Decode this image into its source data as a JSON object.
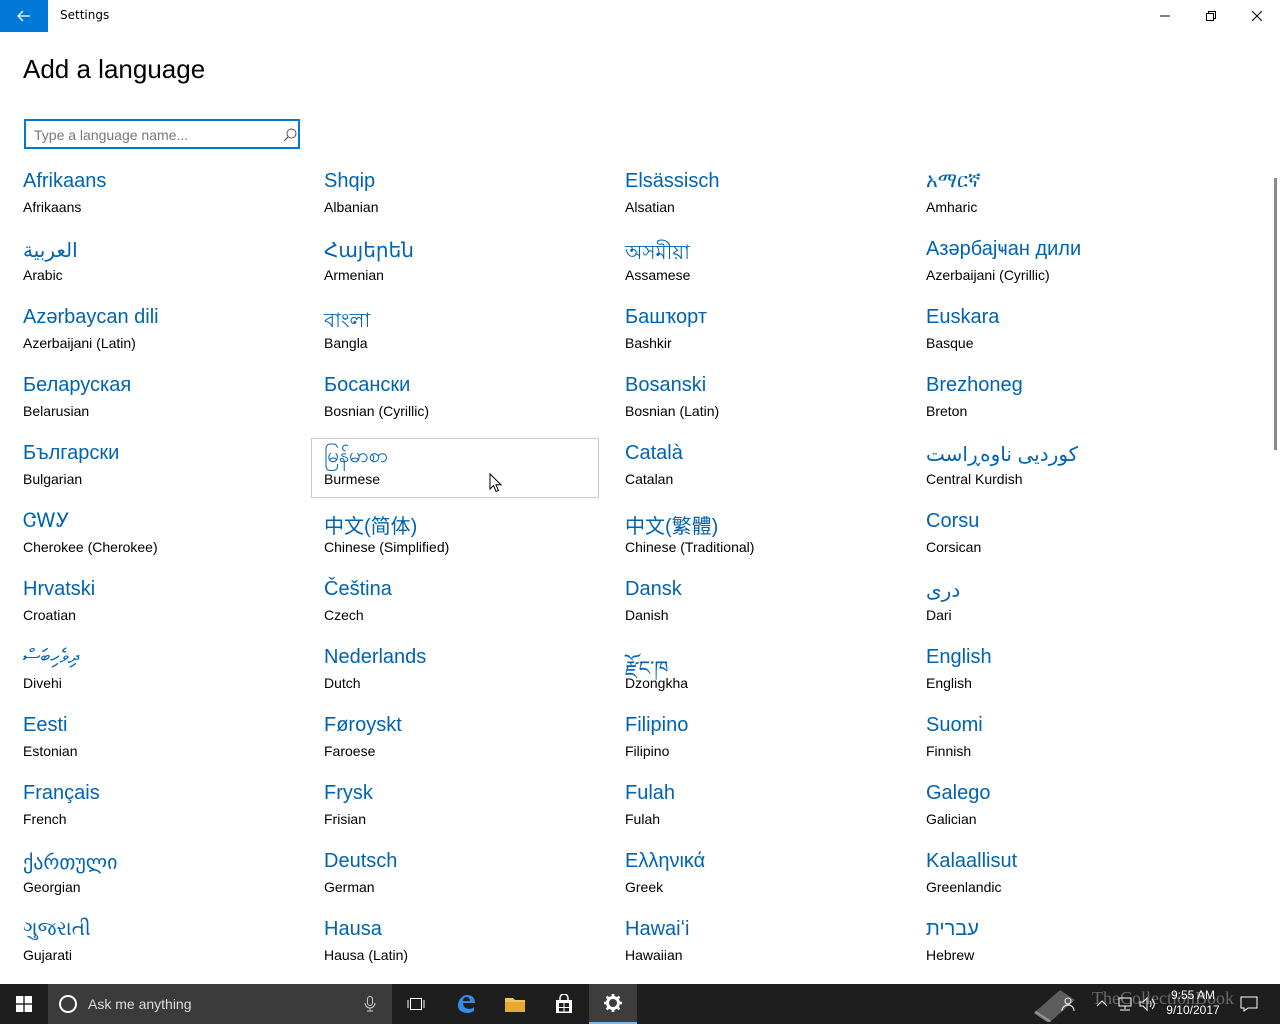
{
  "window": {
    "title": "Settings"
  },
  "page": {
    "title": "Add a language"
  },
  "search": {
    "placeholder": "Type a language name..."
  },
  "languages": [
    {
      "native": "Afrikaans",
      "english": "Afrikaans"
    },
    {
      "native": "Shqip",
      "english": "Albanian"
    },
    {
      "native": "Elsässisch",
      "english": "Alsatian"
    },
    {
      "native": "አማርኛ",
      "english": "Amharic"
    },
    {
      "native": "العربية",
      "english": "Arabic"
    },
    {
      "native": "Հայերեն",
      "english": "Armenian"
    },
    {
      "native": "অসমীয়া",
      "english": "Assamese"
    },
    {
      "native": "Азәрбајҹан дили",
      "english": "Azerbaijani (Cyrillic)"
    },
    {
      "native": "Azərbaycan dili",
      "english": "Azerbaijani (Latin)"
    },
    {
      "native": "বাংলা",
      "english": "Bangla"
    },
    {
      "native": "Башҡорт",
      "english": "Bashkir"
    },
    {
      "native": "Euskara",
      "english": "Basque"
    },
    {
      "native": "Беларуская",
      "english": "Belarusian"
    },
    {
      "native": "Босански",
      "english": "Bosnian (Cyrillic)"
    },
    {
      "native": "Bosanski",
      "english": "Bosnian (Latin)"
    },
    {
      "native": "Brezhoneg",
      "english": "Breton"
    },
    {
      "native": "Български",
      "english": "Bulgarian"
    },
    {
      "native": "မြန်မာစာ",
      "english": "Burmese"
    },
    {
      "native": "Català",
      "english": "Catalan"
    },
    {
      "native": "کوردیی ناوەڕاست",
      "english": "Central Kurdish"
    },
    {
      "native": "ᏣᎳᎩ",
      "english": "Cherokee (Cherokee)"
    },
    {
      "native": "中文(简体)",
      "english": "Chinese (Simplified)"
    },
    {
      "native": "中文(繁體)",
      "english": "Chinese (Traditional)"
    },
    {
      "native": "Corsu",
      "english": "Corsican"
    },
    {
      "native": "Hrvatski",
      "english": "Croatian"
    },
    {
      "native": "Čeština",
      "english": "Czech"
    },
    {
      "native": "Dansk",
      "english": "Danish"
    },
    {
      "native": "درى",
      "english": "Dari"
    },
    {
      "native": "ދިވެހިބަސް",
      "english": "Divehi"
    },
    {
      "native": "Nederlands",
      "english": "Dutch"
    },
    {
      "native": "རྫོང་ཁ",
      "english": "Dzongkha"
    },
    {
      "native": "English",
      "english": "English"
    },
    {
      "native": "Eesti",
      "english": "Estonian"
    },
    {
      "native": "Føroyskt",
      "english": "Faroese"
    },
    {
      "native": "Filipino",
      "english": "Filipino"
    },
    {
      "native": "Suomi",
      "english": "Finnish"
    },
    {
      "native": "Français",
      "english": "French"
    },
    {
      "native": "Frysk",
      "english": "Frisian"
    },
    {
      "native": "Fulah",
      "english": "Fulah"
    },
    {
      "native": "Galego",
      "english": "Galician"
    },
    {
      "native": "ქართული",
      "english": "Georgian"
    },
    {
      "native": "Deutsch",
      "english": "German"
    },
    {
      "native": "Ελληνικά",
      "english": "Greek"
    },
    {
      "native": "Kalaallisut",
      "english": "Greenlandic"
    },
    {
      "native": "ગુજરાતી",
      "english": "Gujarati"
    },
    {
      "native": "Hausa",
      "english": "Hausa (Latin)"
    },
    {
      "native": "Hawaiʻi",
      "english": "Hawaiian"
    },
    {
      "native": "עברית",
      "english": "Hebrew"
    }
  ],
  "hovered_language": "Burmese",
  "taskbar": {
    "search_text": "Ask me anything",
    "time": "9:55 AM",
    "date": "9/10/2017",
    "watermark": "TheCollectionBook"
  },
  "colors": {
    "accent": "#0078d7",
    "link": "#0063b1",
    "taskbar": "#1e1e1e"
  }
}
